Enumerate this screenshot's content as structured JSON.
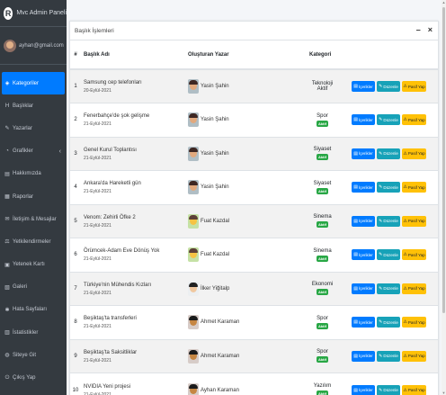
{
  "brand": {
    "logo": "R",
    "title": "Mvc Admin Paneli"
  },
  "user": {
    "email": "ayhan@gmail.com"
  },
  "sidebar": {
    "items": [
      {
        "label": "Kategoriler",
        "icon": "tags-icon",
        "glyph": "◈",
        "active": true
      },
      {
        "label": "Başlıklar",
        "icon": "heading-icon",
        "glyph": "H"
      },
      {
        "label": "Yazarlar",
        "icon": "pen-icon",
        "glyph": "✎"
      },
      {
        "label": "Grafikler",
        "icon": "chart-icon",
        "glyph": "◔",
        "chevron": "‹"
      },
      {
        "label": "Hakkımızda",
        "icon": "book-icon",
        "glyph": "▤"
      },
      {
        "label": "Raporlar",
        "icon": "file-icon",
        "glyph": "▦"
      },
      {
        "label": "İletişim & Mesajlar",
        "icon": "envelope-icon",
        "glyph": "✉"
      },
      {
        "label": "Yetkilendirmeler",
        "icon": "gavel-icon",
        "glyph": "⚖"
      },
      {
        "label": "Yetenek Kartı",
        "icon": "id-card-icon",
        "glyph": "▣"
      },
      {
        "label": "Galeri",
        "icon": "image-icon",
        "glyph": "▧"
      },
      {
        "label": "Hata Sayfaları",
        "icon": "bug-icon",
        "glyph": "✱"
      },
      {
        "label": "İstatistikler",
        "icon": "stats-icon",
        "glyph": "▥"
      },
      {
        "label": "Siteye Git",
        "icon": "globe-icon",
        "glyph": "◍"
      },
      {
        "label": "Çıkış Yap",
        "icon": "logout-icon",
        "glyph": "⏻"
      }
    ]
  },
  "card": {
    "title": "Başlık İşlemleri",
    "minimize": "–",
    "close": "×"
  },
  "table": {
    "headers": {
      "no": "#",
      "title": "Başlık Adı",
      "author": "Oluşturan Yazar",
      "category": "Kategori"
    },
    "buttons": {
      "contents": "İçerikler",
      "edit": "Düzenle",
      "passive": "Pasif Yap"
    },
    "rows": [
      {
        "no": "1",
        "title": "Samsung cep telefonları",
        "date": "20-Eylül-2021",
        "author": "Yasin Şahin",
        "avatar": "a1",
        "category": "Teknoloji",
        "status": "Aktif",
        "status_style": "text"
      },
      {
        "no": "2",
        "title": "Fenerbahçe'de şok gelişme",
        "date": "21-Eylül-2021",
        "author": "Yasin Şahin",
        "avatar": "a1",
        "category": "Spor",
        "status": "Aktif",
        "status_style": "badge"
      },
      {
        "no": "3",
        "title": "Genel Kurul Toplantısı",
        "date": "21-Eylül-2021",
        "author": "Yasin Şahin",
        "avatar": "a1",
        "category": "Siyaset",
        "status": "Aktif",
        "status_style": "badge"
      },
      {
        "no": "4",
        "title": "Ankara'da Hareketli gün",
        "date": "21-Eylül-2021",
        "author": "Yasin Şahin",
        "avatar": "a1",
        "category": "Siyaset",
        "status": "Aktif",
        "status_style": "badge"
      },
      {
        "no": "5",
        "title": "Venom: Zehirli Öfke 2",
        "date": "21-Eylül-2021",
        "author": "Fuat Kazdal",
        "avatar": "a2",
        "category": "Sinema",
        "status": "Aktif",
        "status_style": "badge"
      },
      {
        "no": "6",
        "title": "Örümcek-Adam Eve Dönüş Yok",
        "date": "21-Eylül-2021",
        "author": "Fuat Kazdal",
        "avatar": "a2",
        "category": "Sinema",
        "status": "Aktif",
        "status_style": "badge"
      },
      {
        "no": "7",
        "title": "Türkiye'nin Mühendis Kızları",
        "date": "21-Eylül-2021",
        "author": "İlker Yiğitalp",
        "avatar": "a3",
        "category": "Ekonomi",
        "status": "Aktif",
        "status_style": "badge"
      },
      {
        "no": "8",
        "title": "Beşiktaş'ta transferleri",
        "date": "21-Eylül-2021",
        "author": "Ahmet Karaman",
        "avatar": "a4",
        "category": "Spor",
        "status": "Aktif",
        "status_style": "badge"
      },
      {
        "no": "9",
        "title": "Beşiktaş'ta Saksitliklar",
        "date": "21-Eylül-2021",
        "author": "Ahmet Karaman",
        "avatar": "a4",
        "category": "Spor",
        "status": "Aktif",
        "status_style": "badge"
      },
      {
        "no": "10",
        "title": "NVIDIA Yeni projesi",
        "date": "21-Eylül-2021",
        "author": "Ayhan Karaman",
        "avatar": "a4",
        "category": "Yazılım",
        "status": "Aktif",
        "status_style": "badge"
      }
    ]
  },
  "colors": {
    "sidebar_bg": "#343a40",
    "primary": "#007bff",
    "info": "#17a2b8",
    "warning": "#ffc107",
    "success": "#28a745"
  }
}
